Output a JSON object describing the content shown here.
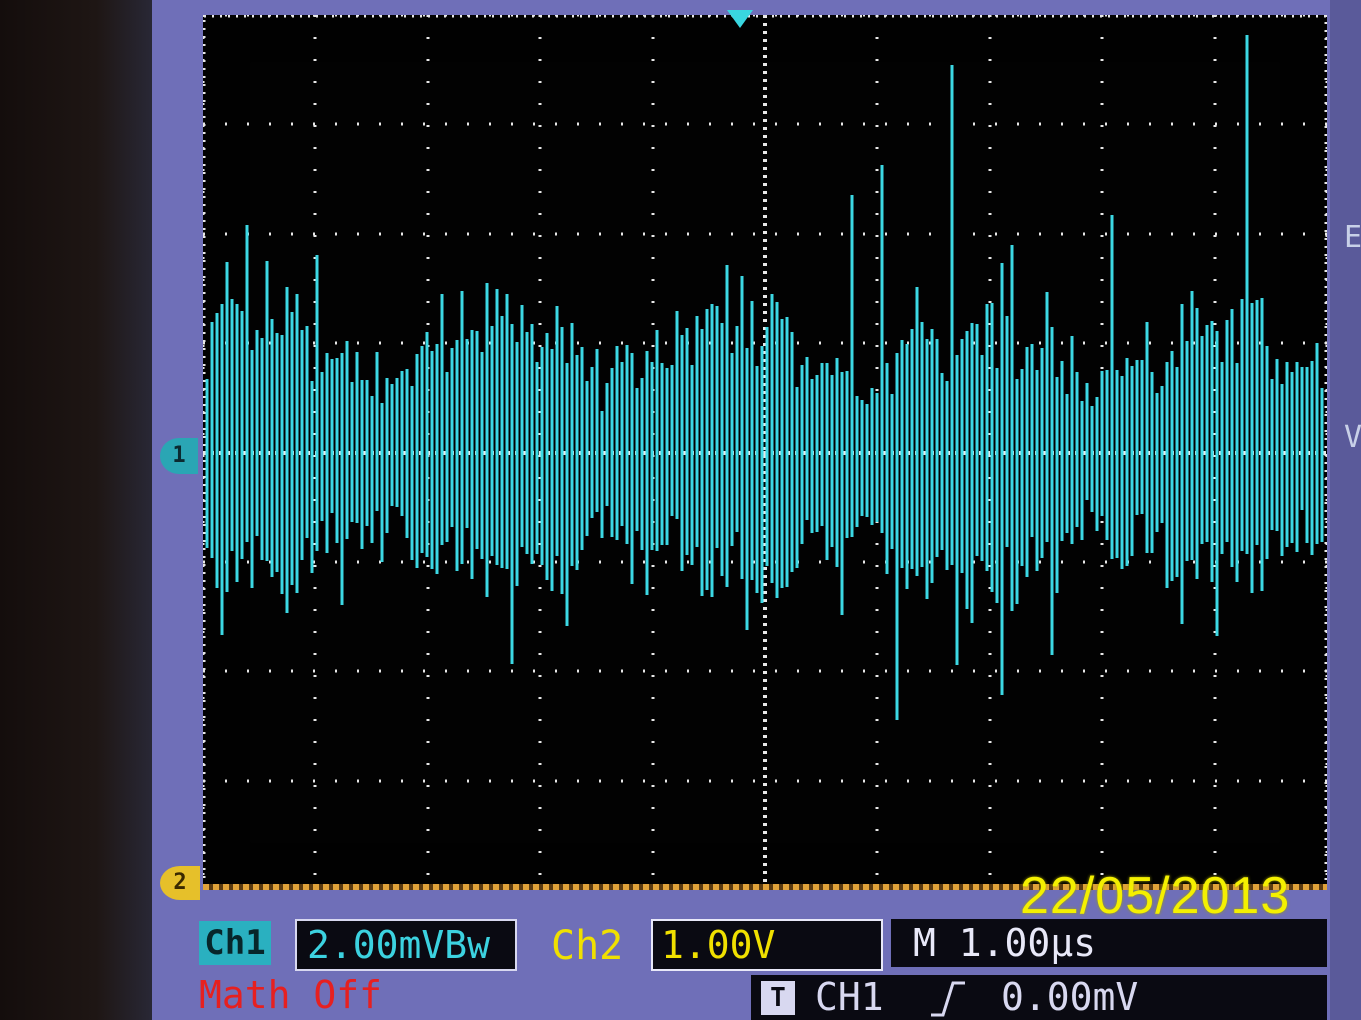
{
  "screen": {
    "ch1_marker_label": "1",
    "ch2_marker_label": "2",
    "date": "22/05/2013",
    "side_letters": [
      "E",
      "V"
    ]
  },
  "status": {
    "ch1_label": "Ch1",
    "ch1_scale": "2.00mVBw",
    "ch2_label": "Ch2",
    "ch2_scale": "1.00V",
    "timebase": "M 1.00µs",
    "math": "Math Off",
    "trigger_source": "CH1",
    "trigger_level": "0.00mV"
  },
  "colors": {
    "ch1": "#3cd8e4",
    "ch2": "#f0e000",
    "math": "#e62020",
    "grid": "#e8e8e8",
    "bezel": "#6f6fb8"
  },
  "icons": {
    "trigger_position": "triangle-down-icon",
    "trigger_type": "t-icon",
    "trigger_slope": "rising-edge-icon"
  }
}
